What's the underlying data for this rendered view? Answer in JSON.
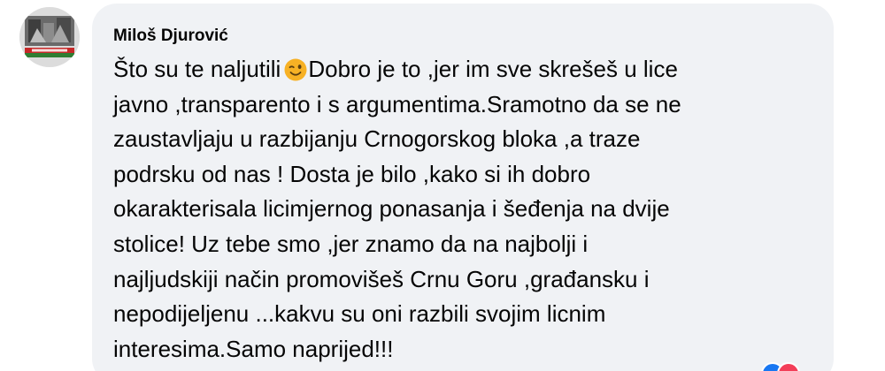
{
  "comment": {
    "author": "Miloš Djurović",
    "lines": [
      "Što su te naljutili",
      "Dobro je to ,jer im sve skrešeš u lice",
      "javno ,transparento i s argumentima.Sramotno da se ne",
      "zaustavljaju u razbijanju Crnogorskog bloka ,a traze",
      "podrsku od nas ! Dosta je bilo ,kako si ih dobro",
      "okarakterisala licimjernog ponasanja i šeđenja na dvije",
      "stolice! Uz tebe smo ,jer znamo da na najbolji i",
      "najljudskiji način promovišeš Crnu Goru ,građansku i",
      "nepodijeljenu ...kakvu su oni razbili svojim licnim",
      "interesima.Samo naprijed!!!"
    ],
    "emoji": "winking-face-icon",
    "reactions": [
      "like-icon",
      "love-icon"
    ]
  },
  "colors": {
    "bubble_background": "#f0f2f5",
    "text": "#050505",
    "like": "#1877f2",
    "love": "#f33e58"
  }
}
